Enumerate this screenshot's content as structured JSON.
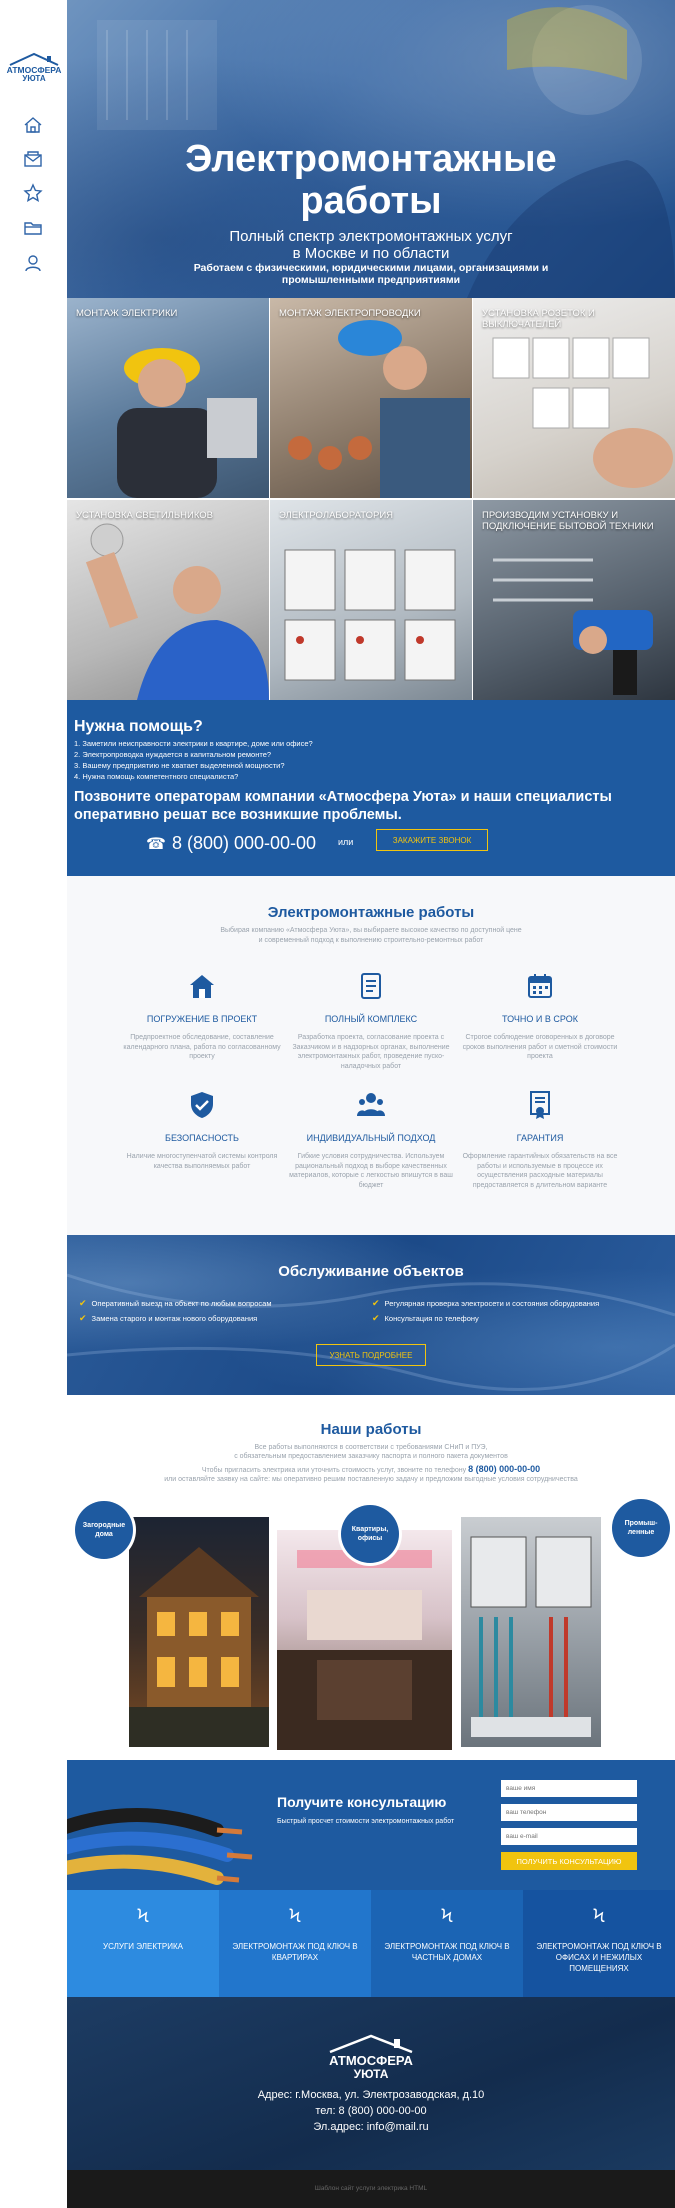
{
  "sidebar": {
    "logo_line1": "АТМОСФЕРА",
    "logo_line2": "УЮТА",
    "nav": [
      "home-icon",
      "mail-icon",
      "star-icon",
      "folder-icon",
      "user-icon"
    ]
  },
  "hero": {
    "title_line1": "Электромонтажные",
    "title_line2": "работы",
    "subtitle_line1": "Полный спектр электромонтажных услуг",
    "subtitle_line2": "в Москве и по области",
    "tagline_line1": "Работаем с физическими, юридическими лицами, организациями и",
    "tagline_line2": "промышленными предприятиями"
  },
  "services": [
    {
      "label": "Монтаж электрики"
    },
    {
      "label": "Монтаж электропроводки"
    },
    {
      "label": "Установка розеток и выключателей"
    },
    {
      "label": "Установка светильников"
    },
    {
      "label": "Электролаборатория"
    },
    {
      "label": "Производим установку и подключение бытовой техники"
    }
  ],
  "help": {
    "title": "Нужна помощь?",
    "items": [
      "1. Заметили неисправности электрики в квартире, доме или офисе?",
      "2. Электропроводка нуждается в капитальном ремонте?",
      "3. Вашему предприятию не хватает выделенной мощности?",
      "4. Нужна помощь компетентного специалиста?"
    ],
    "call_text": "Позвоните операторам компании «Атмосфера Уюта» и наши специалисты оперативно решат все возникшие проблемы.",
    "phone": "8 (800) 000-00-00",
    "or": "или",
    "callback_button": "Закажите звонок"
  },
  "features": {
    "title": "Электромонтажные работы",
    "intro_line1": "Выбирая компанию «Атмосфера Уюта», вы выбираете высокое качество по доступной цене",
    "intro_line2": "и современный подход к выполнению строительно-ремонтных работ",
    "items": [
      {
        "icon": "house-icon",
        "title": "Погружение в проект",
        "text": "Предпроектное обследование, составление календарного плана, работа по согласованному проекту"
      },
      {
        "icon": "document-icon",
        "title": "Полный комплекс",
        "text": "Разработка проекта, согласование проекта с Заказчиком и в надзорных органах, выполнение электромонтажных работ, проведение пуско-наладочных работ"
      },
      {
        "icon": "calendar-icon",
        "title": "Точно и в срок",
        "text": "Строгое соблюдение оговоренных в договоре сроков выполнения работ и сметной стоимости проекта"
      },
      {
        "icon": "shield-check-icon",
        "title": "Безопасность",
        "text": "Наличие многоступенчатой системы контроля качества выполняемых работ"
      },
      {
        "icon": "people-icon",
        "title": "Индивидуальный подход",
        "text": "Гибкие условия сотрудничества. Используем рациональный подход в выборе качественных материалов, которые с легкостью впишутся в ваш бюджет"
      },
      {
        "icon": "certificate-icon",
        "title": "Гарантия",
        "text": "Оформление гарантийных обязательств на все работы и используемые в процессе их осуществления расходные материалы предоставляется в длительном варианте"
      }
    ]
  },
  "maintenance": {
    "title": "Обслуживание объектов",
    "items": [
      "Оперативный выезд на объект по любым вопросам",
      "Регулярная проверка электросети и состояния оборудования",
      "Замена старого и монтаж нового оборудования",
      "Консультация по телефону"
    ],
    "button": "Узнать подробнее"
  },
  "works": {
    "title": "Наши работы",
    "p1_line1": "Все работы выполняются в соответствии с требованиями СНиП и ПУЭ,",
    "p1_line2": "с обязательным предоставлением заказчику паспорта и полного пакета документов",
    "p2_line1": "Чтобы пригласить электрика или уточнить стоимость услуг, звоните по телефону",
    "phone": "8 (800) 000-00-00",
    "p2_line2": "или оставляйте заявку на сайте: мы оперативно решим поставленную задачу и предложим выгодные условия сотрудничества",
    "categories": [
      "Загородные дома",
      "Квартиры, офисы",
      "Промыш-ленные"
    ]
  },
  "consult": {
    "title": "Получите консультацию",
    "subtitle": "Быстрый просчет стоимости электромонтажных работ",
    "name_placeholder": "ваше имя",
    "phone_placeholder": "ваш телефон",
    "email_placeholder": "ваш e-mail",
    "button": "Получить консультацию"
  },
  "service_bar": [
    {
      "label": "Услуги электрика",
      "color": "#2d8be0"
    },
    {
      "label": "Электромонтаж под ключ в квартирах",
      "color": "#2276cc"
    },
    {
      "label": "Электромонтаж под ключ в частных домах",
      "color": "#1b64b4"
    },
    {
      "label": "Электромонтаж под ключ в офисах и нежилых помещениях",
      "color": "#1553a0"
    }
  ],
  "footer": {
    "logo_line1": "АТМОСФЕРА",
    "logo_line2": "УЮТА",
    "address": "Адрес: г.Москва, ул. Электрозаводская, д.10",
    "phone": "тел: 8 (800) 000-00-00",
    "email": "Эл.адрес: info@mail.ru",
    "copyright": "Шаблон сайт услуги электрика HTML"
  },
  "colors": {
    "brand": "#1e5aa0",
    "accent": "#f1c40f",
    "footer": "#132c4d"
  }
}
